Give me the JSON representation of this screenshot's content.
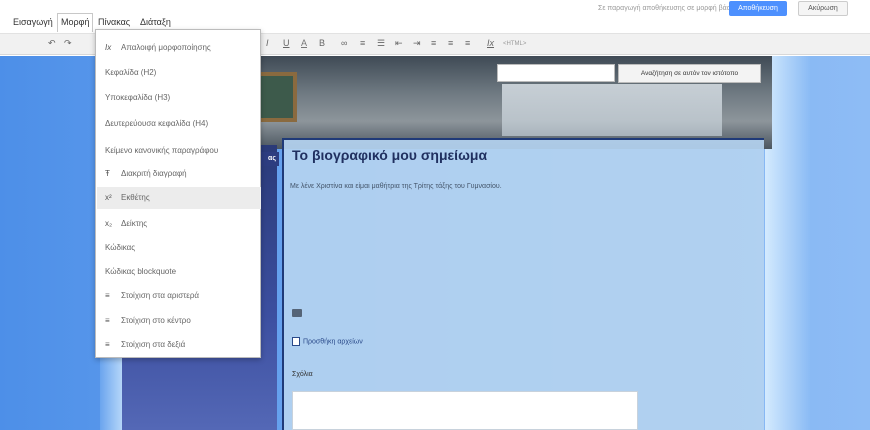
{
  "menubar": {
    "items": [
      "Εισαγωγή",
      "Μορφή",
      "Πίνακας",
      "Διάταξη"
    ],
    "active": "Μορφή",
    "top_note": "Σε παραγωγή αποθήκευσης σε μορφή βάσης",
    "primary_button": "Αποθήκευση",
    "secondary_button": "Ακύρωση"
  },
  "toolbar": {
    "undo": "↶",
    "redo": "↷",
    "italic": "I",
    "underline": "U",
    "font_color": "A",
    "bg_color": "B",
    "link": "∞",
    "list_numbered": "≡",
    "list_bulleted": "☰",
    "indent_less": "⇤",
    "indent_more": "⇥",
    "align_left": "≡",
    "align_center": "≡",
    "align_right": "≡",
    "clear_format": "Ix",
    "html_label": "<HTML>"
  },
  "format_menu": {
    "items": [
      {
        "label": "Απαλοιφή μορφοποίησης",
        "icon": "Ix"
      },
      {
        "label": "Κεφαλίδα (H2)",
        "icon": ""
      },
      {
        "label": "Υποκεφαλίδα (H3)",
        "icon": ""
      },
      {
        "label": "Δευτερεύουσα κεφαλίδα (H4)",
        "icon": ""
      },
      {
        "label": "Κείμενο κανονικής παραγράφου",
        "icon": ""
      },
      {
        "label": "Διακριτή διαγραφή",
        "icon": "Ŧ"
      },
      {
        "label": "Εκθέτης",
        "icon": "x²"
      },
      {
        "label": "Δείκτης",
        "icon": "x₂"
      },
      {
        "label": "Κώδικας",
        "icon": ""
      },
      {
        "label": "Κώδικας blockquote",
        "icon": ""
      },
      {
        "label": "Στοίχιση στα αριστερά",
        "icon": "≡"
      },
      {
        "label": "Στοίχιση στο κέντρο",
        "icon": "≡"
      },
      {
        "label": "Στοίχιση στα δεξιά",
        "icon": "≡"
      }
    ],
    "highlighted_index": 6
  },
  "page": {
    "header_search_button": "Αναζήτηση σε αυτόν τον ιστότοπο",
    "nav_tab": "ας",
    "title": "Το βιογραφικό μου σημείωμα",
    "body_text": "Με λένε Χριστίνα και είμαι μαθήτρια της Τρίτης τάξης του Γυμνασίου.",
    "add_files": "Προσθήκη αρχείων",
    "comments_label": "Σχόλια"
  },
  "colors": {
    "accent": "#4d90fe",
    "highlight": "#ececec",
    "title": "#203060"
  }
}
